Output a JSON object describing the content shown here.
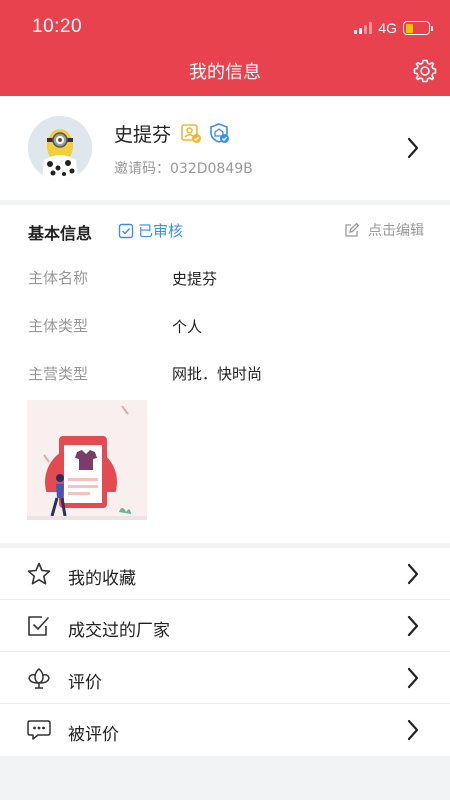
{
  "status_bar": {
    "time": "10:20",
    "network": "4G"
  },
  "header": {
    "title": "我的信息"
  },
  "profile": {
    "name": "史提芬",
    "invite_code": "邀请码：032D0849B"
  },
  "basic_info": {
    "title": "基本信息",
    "verified_label": "已审核",
    "edit_label": "点击编辑",
    "rows": [
      {
        "label": "主体名称",
        "value": "史提芬"
      },
      {
        "label": "主体类型",
        "value": "个人"
      },
      {
        "label": "主营类型",
        "value": "网批．快时尚"
      }
    ]
  },
  "menu": [
    {
      "label": "我的收藏",
      "icon": "star-icon"
    },
    {
      "label": "成交过的厂家",
      "icon": "checkbox-icon"
    },
    {
      "label": "评价",
      "icon": "flower-icon"
    },
    {
      "label": "被评价",
      "icon": "chat-bubble-icon"
    }
  ],
  "colors": {
    "brand": "#e8424e",
    "verified": "#3b8fe6",
    "badge_gold": "#f0b62d"
  }
}
